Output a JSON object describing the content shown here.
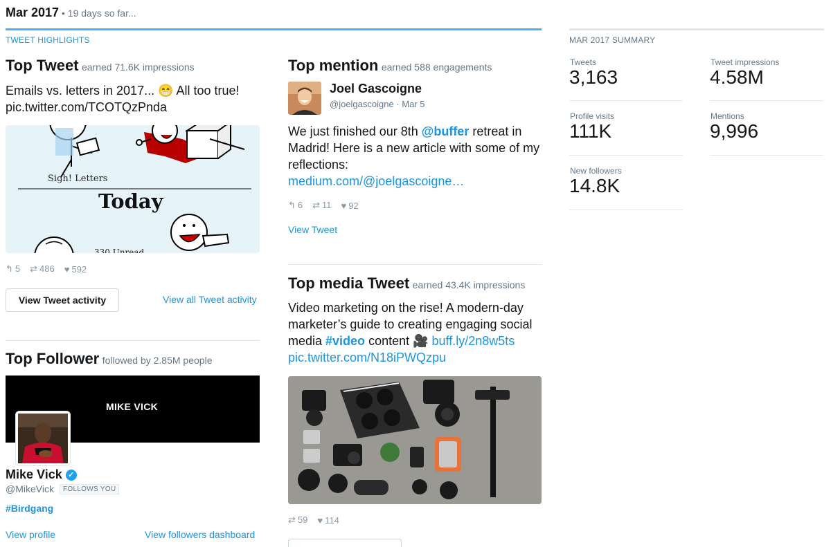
{
  "header": {
    "month": "Mar 2017",
    "subtitle": "• 19 days so far..."
  },
  "highlights": {
    "label": "TWEET HIGHLIGHTS",
    "top_tweet": {
      "title": "Top Tweet",
      "sub": "earned 71.6K impressions",
      "text": "Emails vs. letters in 2017... 😁 All too true!",
      "link": "pic.twitter.com/TCOTQzPnda",
      "image_texts": {
        "sigh": "Sigh! Letters",
        "today": "Today",
        "partial": "330 Unread"
      },
      "replies": "5",
      "retweets": "486",
      "likes": "592",
      "button": "View Tweet activity",
      "view_all": "View all Tweet activity"
    },
    "top_follower": {
      "title": "Top Follower",
      "sub": "followed by 2.85M people",
      "banner_text": "MIKE VICK",
      "name": "Mike Vick",
      "handle": "@MikeVick",
      "follows_badge": "FOLLOWS YOU",
      "hashtag": "#Birdgang",
      "view_profile": "View profile",
      "view_dashboard": "View followers dashboard"
    },
    "top_mention": {
      "title": "Top mention",
      "sub": "earned 588 engagements",
      "name": "Joel Gascoigne",
      "handle": "@joelgascoigne",
      "date": "· Mar 5",
      "text_1": "We just finished our 8th ",
      "mention": "@buffer",
      "text_2": " retreat in Madrid! Here is a new article with some of my reflections:",
      "link": "medium.com/@joelgascoigne…",
      "replies": "6",
      "retweets": "11",
      "likes": "92",
      "view_tweet": "View Tweet"
    },
    "top_media": {
      "title": "Top media Tweet",
      "sub": "earned 43.4K impressions",
      "text_1": "Video marketing on the rise! A modern-day marketer’s guide to creating engaging social media ",
      "hashtag": "#video",
      "text_2": " content 🎥 ",
      "link_1": "buff.ly/2n8w5ts",
      "link_2": "pic.twitter.com/N18iPWQzpu",
      "retweets": "59",
      "likes": "114"
    }
  },
  "summary": {
    "label": "MAR 2017 SUMMARY",
    "tweets_label": "Tweets",
    "tweets": "3,163",
    "impressions_label": "Tweet impressions",
    "impressions": "4.58M",
    "visits_label": "Profile visits",
    "visits": "111K",
    "mentions_label": "Mentions",
    "mentions": "9,996",
    "followers_label": "New followers",
    "followers": "14.8K"
  },
  "icons": {
    "reply": "reply-icon",
    "retweet": "retweet-icon",
    "like": "heart-icon",
    "verified": "verified-badge-icon"
  },
  "colors": {
    "link": "#1b95e0",
    "accent_rule": "#55acee",
    "muted": "#657786"
  }
}
